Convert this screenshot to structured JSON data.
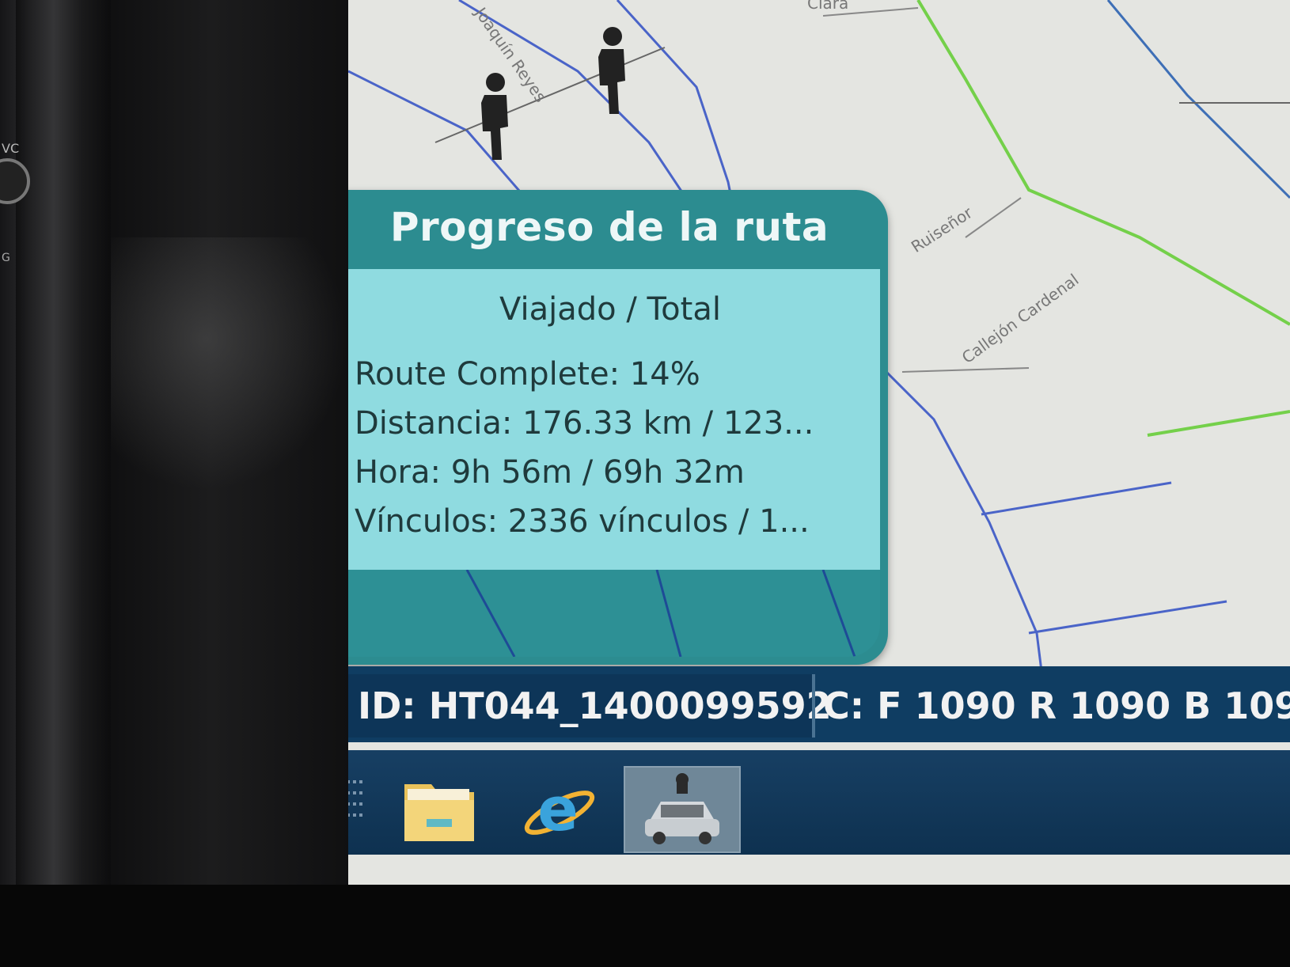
{
  "map": {
    "road_labels": [
      "Joaquín Reyes",
      "Ruiseñor",
      "Callejón Cardenal",
      "Clara"
    ],
    "icons": [
      "pedestrian-crossing-icon",
      "pedestrian-crossing-icon"
    ]
  },
  "panel": {
    "title": "Progreso de la ruta",
    "subtitle": "Viajado / Total",
    "route_complete": "Route Complete: 14%",
    "route_complete_percent": 14,
    "distance": "Distancia: 176.33 km / 123...",
    "time": "Hora: 9h 56m / 69h 32m",
    "links": "Vínculos: 2336 vínculos / 1..."
  },
  "status_bar": {
    "id": "ID: HT044_1400099592",
    "counts": "C: F 1090 R 1090 B 109"
  },
  "taskbar": {
    "items": [
      {
        "icon": "folder-icon"
      },
      {
        "icon": "internet-explorer-icon"
      },
      {
        "icon": "street-view-car-icon",
        "active": true
      }
    ]
  },
  "colors": {
    "panel_header": "#2c8c90",
    "panel_body": "#8fdbe0",
    "status_bar": "#0f3d62",
    "road_blue": "#4a64c8",
    "road_green": "#74d04a"
  }
}
